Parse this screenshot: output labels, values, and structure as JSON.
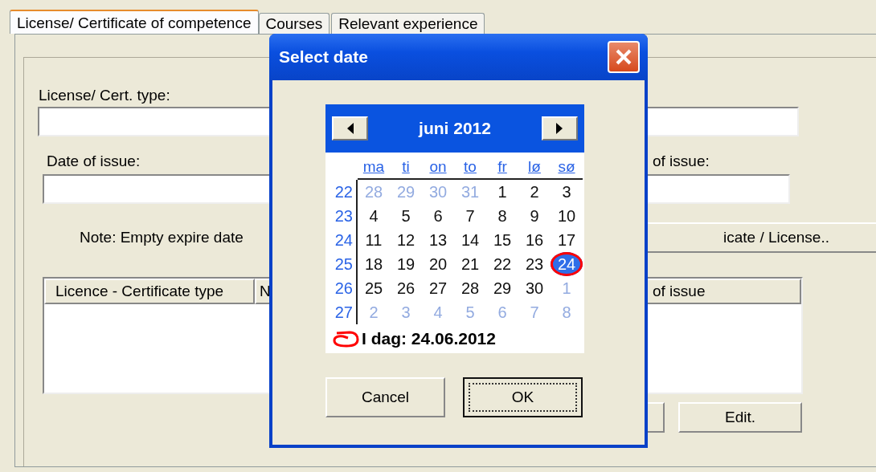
{
  "tabs": [
    {
      "label": "License/ Certificate of competence",
      "selected": true
    },
    {
      "label": "Courses",
      "selected": false
    },
    {
      "label": "Relevant experience",
      "selected": false
    }
  ],
  "form": {
    "cert_type_label": "License/ Cert. type:",
    "date_of_issue_label": "Date of issue:",
    "right_date_label": "of issue:",
    "note": "Note: Empty expire date",
    "add_button": "icate / License..",
    "table": {
      "columns": [
        "Licence - Certificate type",
        "N",
        "of issue"
      ]
    },
    "edit_button": "Edit."
  },
  "dialog": {
    "title": "Select date",
    "month": "juni 2012",
    "weekdays": [
      "ma",
      "ti",
      "on",
      "to",
      "fr",
      "lø",
      "sø"
    ],
    "weeks": [
      {
        "number": "22",
        "days": [
          {
            "label": "28",
            "other_month": true,
            "today": false
          },
          {
            "label": "29",
            "other_month": true,
            "today": false
          },
          {
            "label": "30",
            "other_month": true,
            "today": false
          },
          {
            "label": "31",
            "other_month": true,
            "today": false
          },
          {
            "label": "1",
            "other_month": false,
            "today": false
          },
          {
            "label": "2",
            "other_month": false,
            "today": false
          },
          {
            "label": "3",
            "other_month": false,
            "today": false
          }
        ]
      },
      {
        "number": "23",
        "days": [
          {
            "label": "4",
            "other_month": false,
            "today": false
          },
          {
            "label": "5",
            "other_month": false,
            "today": false
          },
          {
            "label": "6",
            "other_month": false,
            "today": false
          },
          {
            "label": "7",
            "other_month": false,
            "today": false
          },
          {
            "label": "8",
            "other_month": false,
            "today": false
          },
          {
            "label": "9",
            "other_month": false,
            "today": false
          },
          {
            "label": "10",
            "other_month": false,
            "today": false
          }
        ]
      },
      {
        "number": "24",
        "days": [
          {
            "label": "11",
            "other_month": false,
            "today": false
          },
          {
            "label": "12",
            "other_month": false,
            "today": false
          },
          {
            "label": "13",
            "other_month": false,
            "today": false
          },
          {
            "label": "14",
            "other_month": false,
            "today": false
          },
          {
            "label": "15",
            "other_month": false,
            "today": false
          },
          {
            "label": "16",
            "other_month": false,
            "today": false
          },
          {
            "label": "17",
            "other_month": false,
            "today": false
          }
        ]
      },
      {
        "number": "25",
        "days": [
          {
            "label": "18",
            "other_month": false,
            "today": false
          },
          {
            "label": "19",
            "other_month": false,
            "today": false
          },
          {
            "label": "20",
            "other_month": false,
            "today": false
          },
          {
            "label": "21",
            "other_month": false,
            "today": false
          },
          {
            "label": "22",
            "other_month": false,
            "today": false
          },
          {
            "label": "23",
            "other_month": false,
            "today": false
          },
          {
            "label": "24",
            "other_month": false,
            "today": true
          }
        ]
      },
      {
        "number": "26",
        "days": [
          {
            "label": "25",
            "other_month": false,
            "today": false
          },
          {
            "label": "26",
            "other_month": false,
            "today": false
          },
          {
            "label": "27",
            "other_month": false,
            "today": false
          },
          {
            "label": "28",
            "other_month": false,
            "today": false
          },
          {
            "label": "29",
            "other_month": false,
            "today": false
          },
          {
            "label": "30",
            "other_month": false,
            "today": false
          },
          {
            "label": "1",
            "other_month": true,
            "today": false
          }
        ]
      },
      {
        "number": "27",
        "days": [
          {
            "label": "2",
            "other_month": true,
            "today": false
          },
          {
            "label": "3",
            "other_month": true,
            "today": false
          },
          {
            "label": "4",
            "other_month": true,
            "today": false
          },
          {
            "label": "5",
            "other_month": true,
            "today": false
          },
          {
            "label": "6",
            "other_month": true,
            "today": false
          },
          {
            "label": "7",
            "other_month": true,
            "today": false
          },
          {
            "label": "8",
            "other_month": true,
            "today": false
          }
        ]
      }
    ],
    "today_label": "I dag: 24.06.2012",
    "buttons": [
      {
        "label": "Cancel",
        "default": false
      },
      {
        "label": "OK",
        "default": true
      }
    ]
  }
}
